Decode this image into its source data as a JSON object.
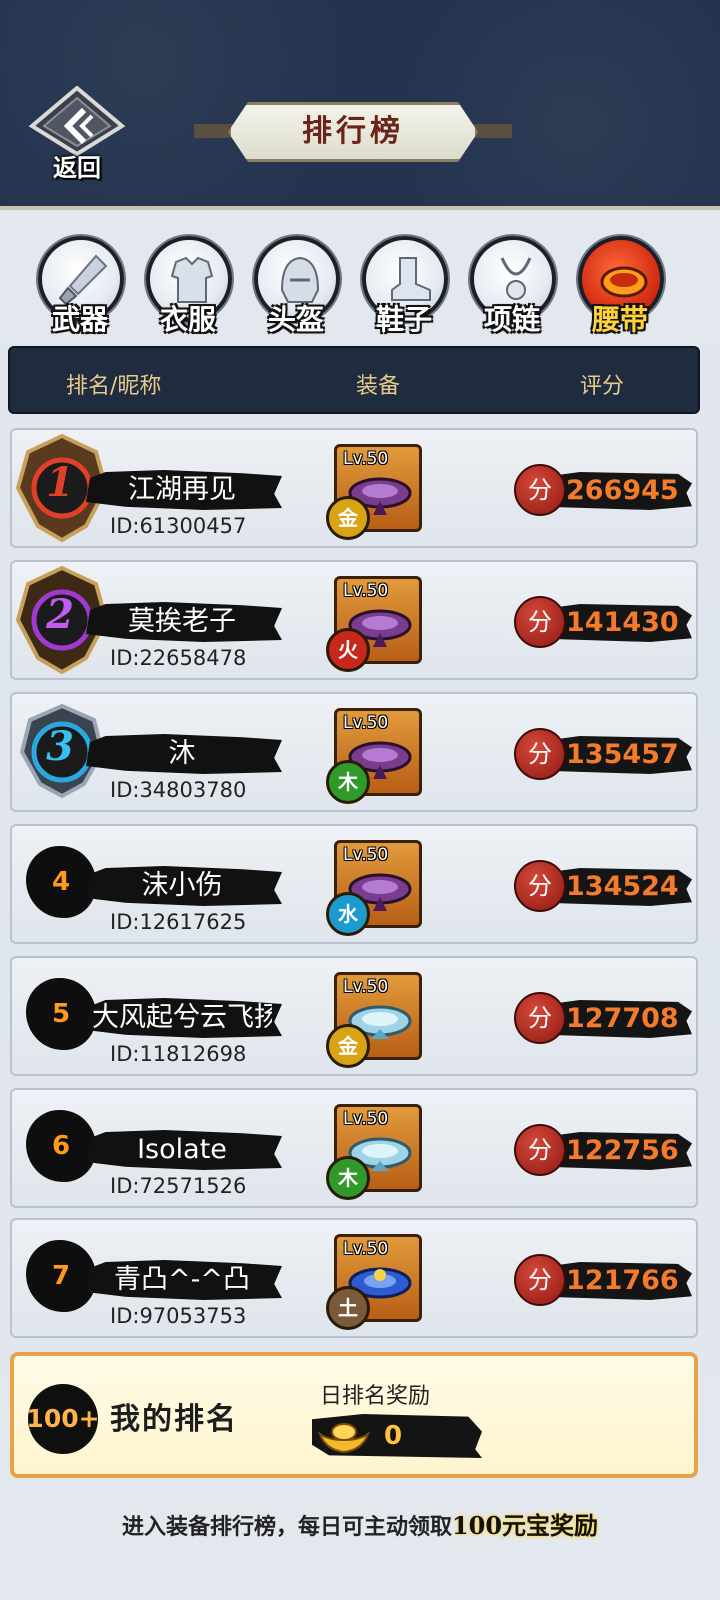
{
  "header": {
    "back_label": "返回",
    "title": "排行榜"
  },
  "tabs": [
    {
      "label": "武器",
      "icon": "sword-icon",
      "active": false
    },
    {
      "label": "衣服",
      "icon": "armor-icon",
      "active": false
    },
    {
      "label": "头盔",
      "icon": "helmet-icon",
      "active": false
    },
    {
      "label": "鞋子",
      "icon": "boot-icon",
      "active": false
    },
    {
      "label": "项链",
      "icon": "necklace-icon",
      "active": false
    },
    {
      "label": "腰带",
      "icon": "belt-icon",
      "active": true
    }
  ],
  "columns": {
    "name": "排名/昵称",
    "equipment": "装备",
    "score": "评分"
  },
  "score_badge": "分",
  "rows": [
    {
      "rank": "1",
      "name": "江湖再见",
      "id": "ID:61300457",
      "level": "Lv.50",
      "element": "金",
      "score": "266945"
    },
    {
      "rank": "2",
      "name": "莫挨老子",
      "id": "ID:22658478",
      "level": "Lv.50",
      "element": "火",
      "score": "141430"
    },
    {
      "rank": "3",
      "name": "沐",
      "id": "ID:34803780",
      "level": "Lv.50",
      "element": "木",
      "score": "135457"
    },
    {
      "rank": "4",
      "name": "沫小伤",
      "id": "ID:12617625",
      "level": "Lv.50",
      "element": "水",
      "score": "134524"
    },
    {
      "rank": "5",
      "name": "大风起兮云飞扬",
      "id": "ID:11812698",
      "level": "Lv.50",
      "element": "金",
      "score": "127708"
    },
    {
      "rank": "6",
      "name": "Isolate",
      "id": "ID:72571526",
      "level": "Lv.50",
      "element": "木",
      "score": "122756"
    },
    {
      "rank": "7",
      "name": "青凸^-^凸",
      "id": "ID:97053753",
      "level": "Lv.50",
      "element": "土",
      "score": "121766"
    }
  ],
  "my_rank": {
    "rank": "100+",
    "label": "我的排名",
    "reward_title": "日排名奖励",
    "reward_value": "0"
  },
  "footer": {
    "text": "进入装备排行榜，每日可主动领取",
    "highlight": "100元宝奖励"
  },
  "colors": {
    "header_bg": "#23324d",
    "score_text": "#f47a2c",
    "medal_gold": "#e0402a",
    "medal_purple": "#a23ad2",
    "medal_blue": "#2aa8e0"
  }
}
